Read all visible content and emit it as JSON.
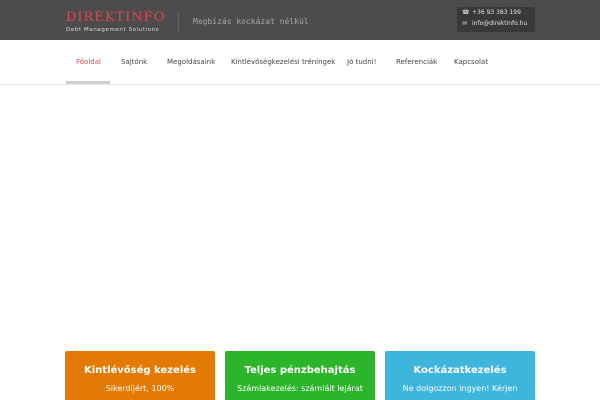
{
  "header": {
    "logo_title": "DIREKTINFO",
    "logo_subtitle": "Debt Management Solutions",
    "tagline": "Megbízás kockázat nélkül",
    "phone": "+36 93 383 199",
    "email": "info@direktinfo.hu",
    "phone_icon": "phone-icon",
    "email_icon": "envelope-icon"
  },
  "nav": {
    "items": [
      "Főoldal",
      "Sajtónk",
      "Megoldásaink",
      "Kintlévőségkezelési tréningek",
      "Jó tudni!",
      "Referenciák",
      "Kapcsolat"
    ],
    "active_index": 0
  },
  "cards": [
    {
      "title": "Kintlévőség kezelés",
      "text": "Sikerdíjért, 100%",
      "color": "#e47a06"
    },
    {
      "title": "Teljes pénzbehajtás",
      "text": "Számlakezelés: számláit lejárat",
      "color": "#2cb52a"
    },
    {
      "title": "Kockázatkezelés",
      "text": "Ne dolgozzon ingyen! Kérjen",
      "color": "#3db5dc"
    }
  ],
  "colors": {
    "accent": "#e0464b",
    "topbar": "#4a4a4a"
  }
}
